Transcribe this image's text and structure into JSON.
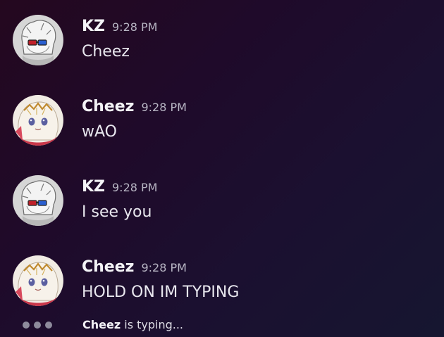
{
  "messages": [
    {
      "author": "KZ",
      "timestamp": "9:28 PM",
      "content": "Cheez",
      "avatar_icon": "kz-avatar-icon"
    },
    {
      "author": "Cheez",
      "timestamp": "9:28 PM",
      "content": "wAO",
      "avatar_icon": "cheez-avatar-icon"
    },
    {
      "author": "KZ",
      "timestamp": "9:28 PM",
      "content": "I see you",
      "avatar_icon": "kz-avatar-icon"
    },
    {
      "author": "Cheez",
      "timestamp": "9:28 PM",
      "content": "HOLD ON IM TYPING",
      "avatar_icon": "cheez-avatar-icon"
    }
  ],
  "typing": {
    "user": "Cheez",
    "text": " is typing..."
  },
  "colors": {
    "background_start": "#24081f",
    "background_end": "#161630",
    "author_text": "#f4f4f7",
    "timestamp_text": "#b8b6c4",
    "typing_dots": "#8e8b9c"
  }
}
